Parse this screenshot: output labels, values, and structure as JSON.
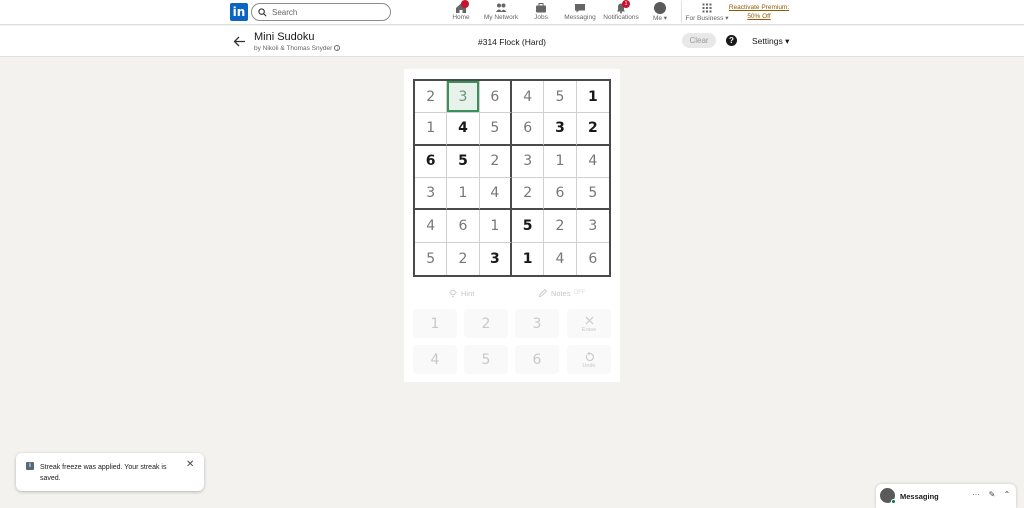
{
  "nav": {
    "logo": "in",
    "search_placeholder": "Search",
    "items": [
      {
        "label": "Home",
        "icon": "home-icon"
      },
      {
        "label": "My Network",
        "icon": "network-icon"
      },
      {
        "label": "Jobs",
        "icon": "briefcase-icon"
      },
      {
        "label": "Messaging",
        "icon": "messaging-icon"
      },
      {
        "label": "Notifications",
        "icon": "bell-icon",
        "badge": "1"
      },
      {
        "label": "Me ▾",
        "icon": "avatar"
      },
      {
        "label": "For Business ▾",
        "icon": "grid-icon"
      }
    ],
    "premium_line1": "Reactivate Premium:",
    "premium_line2": "50% Off"
  },
  "game": {
    "title": "Mini Sudoku",
    "byline": "by Nikoli & Thomas Snyder",
    "puzzle_title": "#314 Flock (Hard)",
    "clear_label": "Clear",
    "help_label": "?",
    "settings_label": "Settings ▾"
  },
  "board": {
    "rows": [
      [
        "2",
        "3",
        "6",
        "4",
        "5",
        "1"
      ],
      [
        "1",
        "4",
        "5",
        "6",
        "3",
        "2"
      ],
      [
        "6",
        "5",
        "2",
        "3",
        "1",
        "4"
      ],
      [
        "3",
        "1",
        "4",
        "2",
        "6",
        "5"
      ],
      [
        "4",
        "6",
        "1",
        "5",
        "2",
        "3"
      ],
      [
        "5",
        "2",
        "3",
        "1",
        "4",
        "6"
      ]
    ],
    "given": [
      [
        false,
        false,
        false,
        false,
        false,
        true
      ],
      [
        false,
        true,
        false,
        false,
        true,
        true
      ],
      [
        true,
        true,
        false,
        false,
        false,
        false
      ],
      [
        false,
        false,
        false,
        false,
        false,
        false
      ],
      [
        false,
        false,
        false,
        true,
        false,
        false
      ],
      [
        false,
        false,
        true,
        true,
        false,
        false
      ]
    ],
    "selected": [
      0,
      1
    ]
  },
  "tools": {
    "hint_label": "Hint",
    "notes_label": "Notes",
    "notes_state": "OFF"
  },
  "keypad": {
    "keys": [
      "1",
      "2",
      "3",
      "4",
      "5",
      "6"
    ],
    "erase_label": "Erase",
    "undo_label": "Undo"
  },
  "toast": {
    "message": "Streak freeze was applied. Your streak is saved.",
    "close": "✕"
  },
  "messaging": {
    "label": "Messaging",
    "more": "···",
    "compose": "✎",
    "collapse": "⌃"
  },
  "colors": {
    "brand": "#0a66c2",
    "selected_cell_border": "#3b8f5c",
    "badge": "#cb112d",
    "premium": "#915907"
  }
}
